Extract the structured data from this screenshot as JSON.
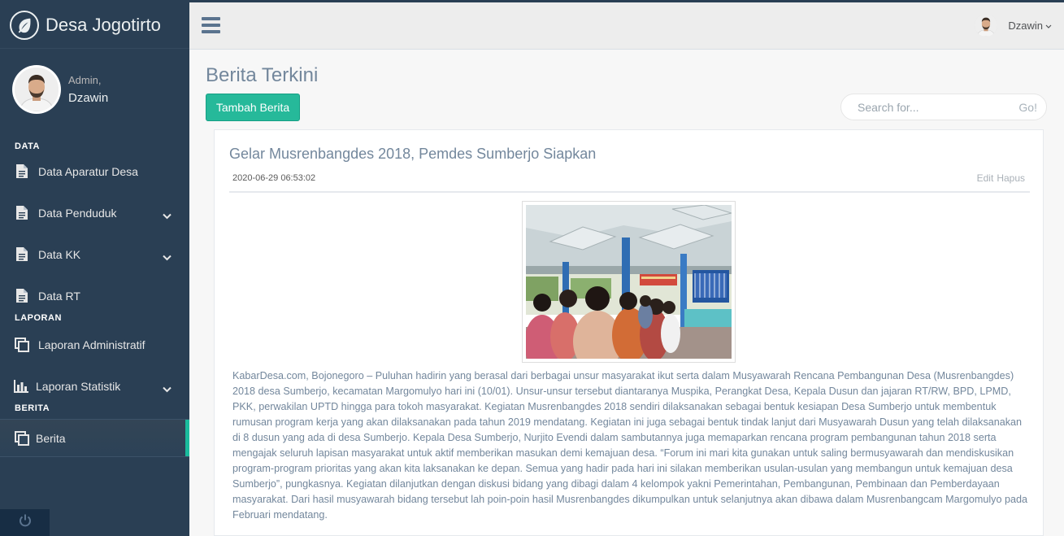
{
  "app": {
    "brand": "Desa Jogotirto"
  },
  "sidebar": {
    "profile": {
      "greeting": "Admin,",
      "name": "Dzawin"
    },
    "sections": [
      {
        "title": "DATA",
        "items": [
          {
            "label": "Data Aparatur Desa",
            "icon": "document-icon",
            "has_submenu": false
          },
          {
            "label": "Data Penduduk",
            "icon": "document-icon",
            "has_submenu": true
          },
          {
            "label": "Data KK",
            "icon": "document-icon",
            "has_submenu": true
          },
          {
            "label": "Data RT",
            "icon": "document-icon",
            "has_submenu": false
          }
        ]
      },
      {
        "title": "LAPORAN",
        "items": [
          {
            "label": "Laporan Administratif",
            "icon": "copy-icon",
            "has_submenu": false
          },
          {
            "label": "Laporan Statistik",
            "icon": "bar-chart-icon",
            "has_submenu": true
          }
        ]
      },
      {
        "title": "BERITA",
        "items": [
          {
            "label": "Berita",
            "icon": "copy-icon",
            "has_submenu": false,
            "active": true
          }
        ]
      }
    ],
    "footer_icon": "power-icon"
  },
  "topbar": {
    "user_name": "Dzawin",
    "menu_icon": "hamburger-icon"
  },
  "main": {
    "page_title": "Berita Terkini",
    "add_button_label": "Tambah Berita",
    "search": {
      "placeholder": "Search for...",
      "button_label": "Go!"
    },
    "article": {
      "title": "Gelar Musrenbangdes 2018, Pemdes Sumberjo Siapkan",
      "date": "2020-06-29 06:53:02",
      "edit_label": "Edit",
      "delete_label": "Hapus",
      "body": "KabarDesa.com, Bojonegoro – Puluhan hadirin yang berasal dari berbagai unsur masyarakat ikut serta dalam Musyawarah Rencana Pembangunan Desa (Musrenbangdes) 2018 desa Sumberjo, kecamatan Margomulyo hari ini (10/01). Unsur-unsur tersebut diantaranya Muspika, Perangkat Desa, Kepala Dusun dan jajaran RT/RW, BPD, LPMD, PKK, perwakilan UPTD hingga para tokoh masyarakat. Kegiatan Musrenbangdes 2018 sendiri dilaksanakan sebagai bentuk kesiapan Desa Sumberjo untuk membentuk rumusan program kerja yang akan dilaksanakan pada tahun 2019 mendatang. Kegiatan ini juga sebagai bentuk tindak lanjut dari Musyawarah Dusun yang telah dilaksanakan di 8 dusun yang ada di desa Sumberjo. Kepala Desa Sumberjo, Nurjito Evendi dalam sambutannya juga memaparkan rencana program pembangunan tahun 2018 serta mengajak seluruh lapisan masyarakat untuk aktif memberikan masukan demi kemajuan desa. “Forum ini mari kita gunakan untuk saling bermusyawarah dan mendiskusikan program-program prioritas yang akan kita laksanakan ke depan. Semua yang hadir pada hari ini silakan memberikan usulan-usulan yang membangun untuk kemajuan desa Sumberjo”, pungkasnya. Kegiatan dilanjutkan dengan diskusi bidang yang dibagi dalam 4 kelompok yakni Pemerintahan, Pembangunan, Pembinaan dan Pemberdayaan masyarakat. Dari hasil musyawarah bidang tersebut lah poin-poin hasil Musrenbangdes dikumpulkan untuk selanjutnya akan dibawa dalam Musrenbangcam Margomulyo pada Februari mendatang."
    }
  },
  "colors": {
    "sidebar_bg": "#2a3f54",
    "accent": "#1abb9c",
    "button_green": "#26b99a",
    "topbar_bg": "#ededed",
    "text": "#73879c"
  }
}
